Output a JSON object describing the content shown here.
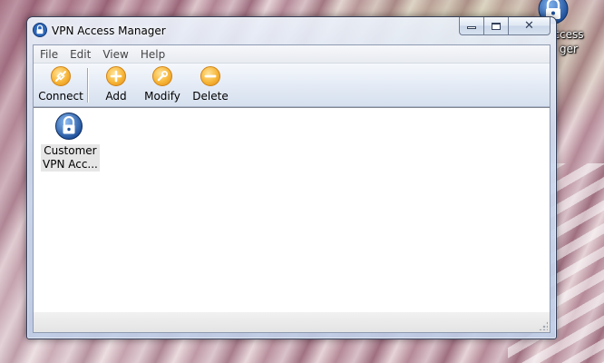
{
  "window": {
    "title": "VPN Access Manager",
    "caption_buttons": {
      "minimize": "minimize",
      "maximize": "maximize",
      "close": "✕"
    }
  },
  "menubar": {
    "items": [
      "File",
      "Edit",
      "View",
      "Help"
    ]
  },
  "toolbar": {
    "buttons": [
      {
        "label": "Connect",
        "icon": "connect-icon"
      },
      {
        "label": "Add",
        "icon": "add-icon"
      },
      {
        "label": "Modify",
        "icon": "wrench-icon"
      },
      {
        "label": "Delete",
        "icon": "minus-icon"
      }
    ]
  },
  "content": {
    "items": [
      {
        "label": "Customer\nVPN Acc...",
        "icon": "vpn-lock-icon"
      }
    ]
  },
  "desktop": {
    "icon_label": "ccess\nger"
  },
  "colors": {
    "accent_orange": "#f7b638",
    "lock_blue": "#2c66b8",
    "title_text": "#000000"
  }
}
